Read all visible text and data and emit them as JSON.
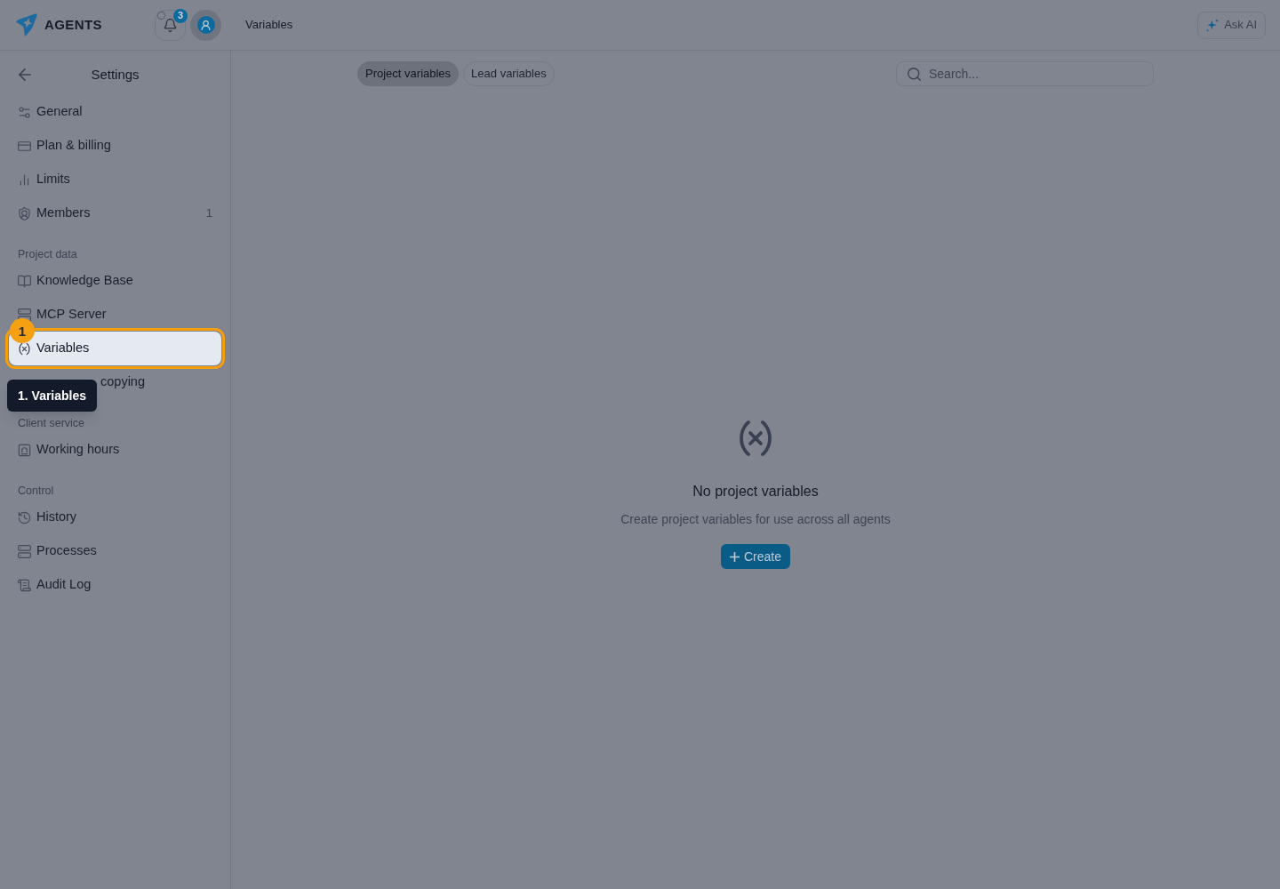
{
  "header": {
    "logo_text": "AGENTS",
    "notifications_count": "3",
    "page_title": "Variables",
    "ask_ai": "Ask AI"
  },
  "sidebar": {
    "title": "Settings",
    "sections": [
      {
        "items": [
          {
            "label": "General",
            "kind": "link",
            "selected": false,
            "highlighted": false
          },
          {
            "label": "Plan & billing",
            "kind": "link",
            "selected": false,
            "highlighted": false
          },
          {
            "label": "Limits",
            "kind": "link",
            "selected": false,
            "highlighted": false
          },
          {
            "label": "Members",
            "kind": "link",
            "count": "1",
            "selected": false,
            "highlighted": false
          }
        ]
      },
      {
        "heading": "Project data",
        "items": [
          {
            "label": "Knowledge Base",
            "kind": "link",
            "selected": false,
            "highlighted": false
          },
          {
            "label": "MCP Server",
            "kind": "link",
            "selected": false,
            "highlighted": false
          },
          {
            "label": "Variables",
            "kind": "link",
            "selected": true,
            "highlighted": true
          },
          {
            "label": "copying",
            "kind": "obscured",
            "selected": false,
            "highlighted": false
          }
        ]
      },
      {
        "heading": "Client service",
        "items": [
          {
            "label": "Working hours",
            "kind": "link",
            "selected": false,
            "highlighted": false
          }
        ]
      },
      {
        "heading": "Control",
        "items": [
          {
            "label": "History",
            "kind": "link",
            "selected": false,
            "highlighted": false
          },
          {
            "label": "Processes",
            "kind": "link",
            "selected": false,
            "highlighted": false
          },
          {
            "label": "Audit Log",
            "kind": "link",
            "selected": false,
            "highlighted": false
          }
        ]
      }
    ]
  },
  "tour": {
    "step": "1",
    "tooltip": "1. Variables"
  },
  "tabs": [
    {
      "label": "Project variables",
      "selected": true
    },
    {
      "label": "Lead variables",
      "selected": false
    }
  ],
  "search": {
    "placeholder": "Search..."
  },
  "empty_state": {
    "title": "No project variables",
    "description": "Create project variables for use across all agents",
    "button": "Create"
  }
}
